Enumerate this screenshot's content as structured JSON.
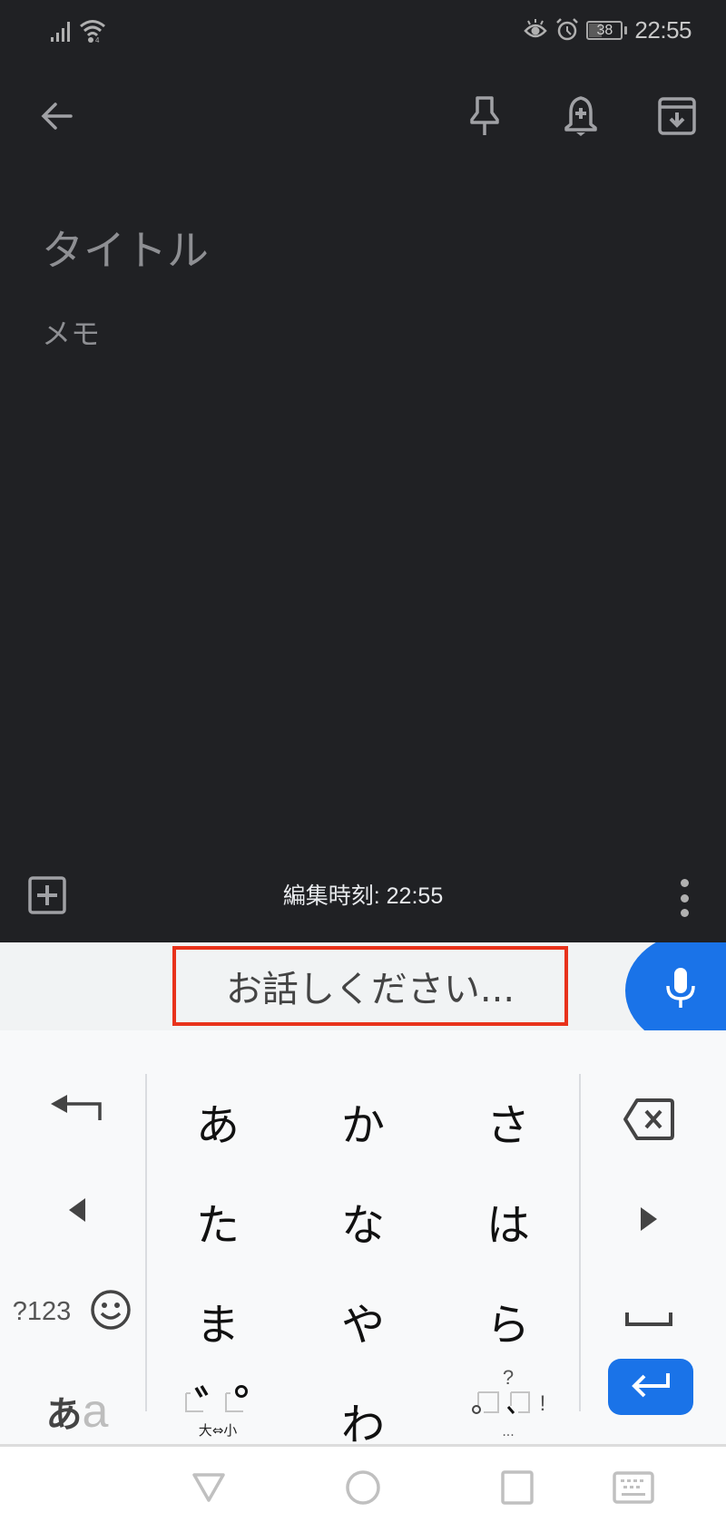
{
  "status_bar": {
    "signal_icon": "cell-signal-icon",
    "wifi_icon": "wifi-icon",
    "eye_icon": "eye-comfort-icon",
    "alarm_icon": "alarm-icon",
    "battery_level": "38",
    "time": "22:55"
  },
  "toolbar": {
    "back_icon": "arrow-left-icon",
    "pin_icon": "pin-icon",
    "reminder_icon": "bell-plus-icon",
    "archive_icon": "archive-icon"
  },
  "note": {
    "title_placeholder": "タイトル",
    "body_placeholder": "メモ"
  },
  "note_bar": {
    "add_icon": "add-box-icon",
    "edited_text": "編集時刻: 22:55",
    "more_icon": "more-vertical-icon"
  },
  "voice_input": {
    "prompt": "お話しください...",
    "mic_icon": "microphone-icon",
    "accent_color": "#1a73e8",
    "highlight_color": "#e8321b"
  },
  "keyboard": {
    "rows": [
      [
        "あ",
        "か",
        "さ"
      ],
      [
        "た",
        "な",
        "は"
      ],
      [
        "ま",
        "や",
        "ら"
      ],
      [
        "",
        "わ",
        ""
      ]
    ],
    "undo_icon": "undo-arrow-icon",
    "backspace_icon": "backspace-icon",
    "cursor_left_icon": "cursor-left-icon",
    "cursor_right_icon": "cursor-right-icon",
    "symbols_label": "?123",
    "emoji_icon": "emoji-icon",
    "space_icon": "space-icon",
    "mode_label_kana": "あ",
    "mode_label_latin": "a",
    "dakuten_label": "大⇔小",
    "punct_top": "?",
    "punct_right": "!",
    "punct_bottom": "...",
    "enter_icon": "enter-icon",
    "enter_color": "#1a73e8"
  },
  "nav_bar": {
    "back_icon": "nav-back-icon",
    "home_icon": "nav-home-icon",
    "recents_icon": "nav-recents-icon",
    "keyboard_icon": "keyboard-switch-icon"
  }
}
